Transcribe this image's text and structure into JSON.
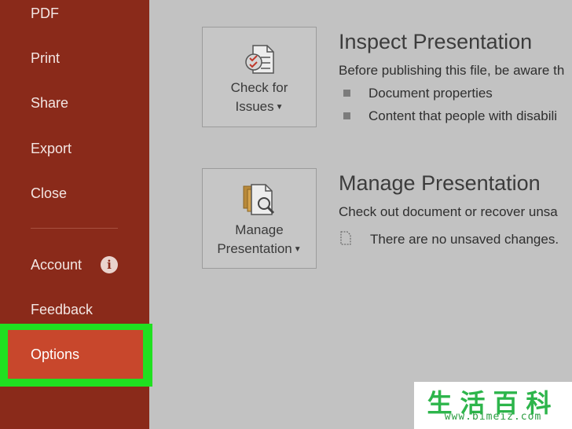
{
  "sidebar": {
    "items": [
      {
        "label": "PDF"
      },
      {
        "label": "Print"
      },
      {
        "label": "Share"
      },
      {
        "label": "Export"
      },
      {
        "label": "Close"
      },
      {
        "label": "Account"
      },
      {
        "label": "Feedback"
      },
      {
        "label": "Options"
      }
    ],
    "account_info_glyph": "i"
  },
  "inspect": {
    "button_line1": "Check for",
    "button_line2": "Issues",
    "title": "Inspect Presentation",
    "description": "Before publishing this file, be aware th",
    "bullets": [
      "Document properties",
      "Content that people with disabili"
    ]
  },
  "manage": {
    "button_line1": "Manage",
    "button_line2": "Presentation",
    "title": "Manage Presentation",
    "description": "Check out document or recover unsa",
    "status": "There are no unsaved changes."
  },
  "watermark": {
    "chinese": "生活百科",
    "url": "www.bimeiz.com"
  },
  "colors": {
    "sidebar": "#8a2a1a",
    "options_selected": "#c8472c",
    "highlight": "#20e020",
    "main_bg": "#c2c2c2"
  },
  "icons": [
    "info-icon",
    "checklist-document-icon",
    "dropdown-caret-icon",
    "magnifier-documents-icon",
    "document-small-icon"
  ]
}
